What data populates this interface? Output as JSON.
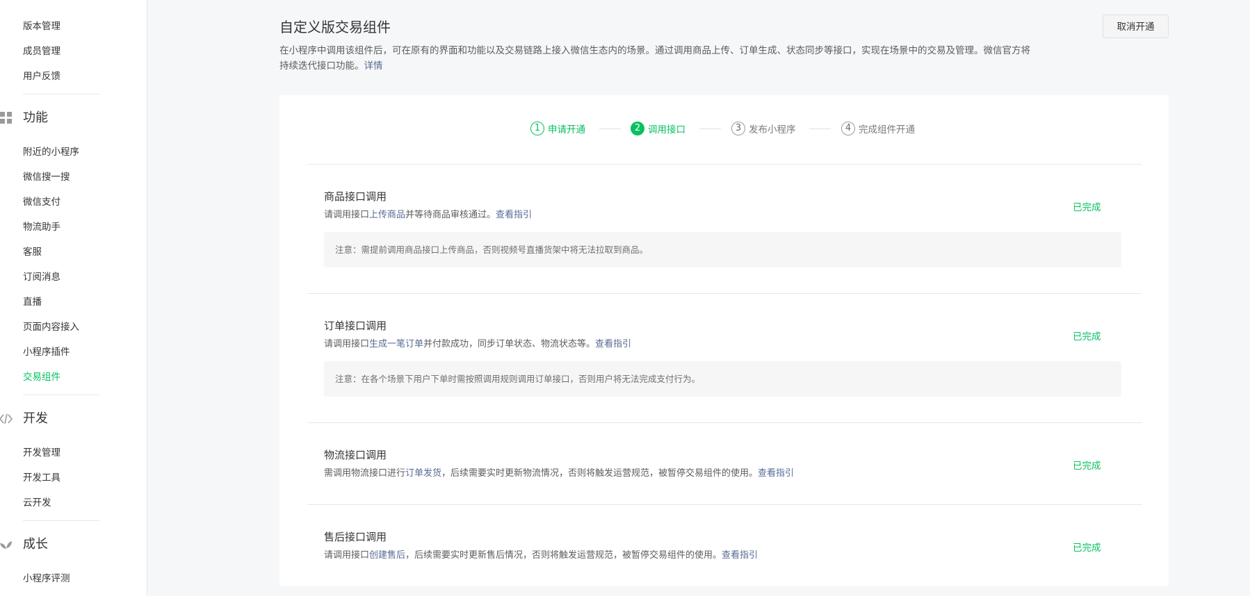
{
  "sidebar": {
    "items_top": [
      "版本管理",
      "成员管理",
      "用户反馈"
    ],
    "section_function": {
      "label": "功能",
      "icon": "grid-icon",
      "items": [
        "附近的小程序",
        "微信搜一搜",
        "微信支付",
        "物流助手",
        "客服",
        "订阅消息",
        "直播",
        "页面内容接入",
        "小程序插件",
        "交易组件"
      ],
      "active_item": "交易组件"
    },
    "section_dev": {
      "label": "开发",
      "icon": "code-icon",
      "items": [
        "开发管理",
        "开发工具",
        "云开发"
      ]
    },
    "section_growth": {
      "label": "成长",
      "icon": "leaf-icon",
      "items": [
        "小程序评测"
      ]
    }
  },
  "header": {
    "title": "自定义版交易组件",
    "desc_text": "在小程序中调用该组件后，可在原有的界面和功能以及交易链路上接入微信生态内的场景。通过调用商品上传、订单生成、状态同步等接口，实现在场景中的交易及管理。微信官方将持续迭代接口功能。",
    "desc_link": "详情",
    "cancel_button": "取消开通"
  },
  "steps": [
    {
      "num": "1",
      "label": "申请开通",
      "state": "done"
    },
    {
      "num": "2",
      "label": "调用接口",
      "state": "current"
    },
    {
      "num": "3",
      "label": "发布小程序",
      "state": "todo"
    },
    {
      "num": "4",
      "label": "完成组件开通",
      "state": "todo"
    }
  ],
  "sections": [
    {
      "title": "商品接口调用",
      "desc_prefix": "请调用接口",
      "desc_link": "上传商品",
      "desc_suffix": "并等待商品审核通过。",
      "guide_link": "查看指引",
      "note": "注意：需提前调用商品接口上传商品，否则视频号直播货架中将无法拉取到商品。",
      "status": "已完成"
    },
    {
      "title": "订单接口调用",
      "desc_prefix": "请调用接口",
      "desc_link": "生成一笔订单",
      "desc_suffix": "并付款成功，同步订单状态、物流状态等。",
      "guide_link": "查看指引",
      "note": "注意：在各个场景下用户下单时需按照调用规则调用订单接口，否则用户将无法完成支付行为。",
      "status": "已完成"
    },
    {
      "title": "物流接口调用",
      "desc_prefix": "需调用物流接口进行",
      "desc_link": "订单发货",
      "desc_suffix": "，后续需要实时更新物流情况，否则将触发运营规范，被暂停交易组件的使用。",
      "guide_link": "查看指引",
      "status": "已完成"
    },
    {
      "title": "售后接口调用",
      "desc_prefix": "请调用接口",
      "desc_link": "创建售后",
      "desc_suffix": "，后续需要实时更新售后情况，否则将触发运营规范，被暂停交易组件的使用。",
      "guide_link": "查看指引",
      "status": "已完成"
    }
  ],
  "colors": {
    "accent": "#07c160",
    "link": "#576b95",
    "text": "#353535",
    "page_bg": "#f6f7f9"
  }
}
